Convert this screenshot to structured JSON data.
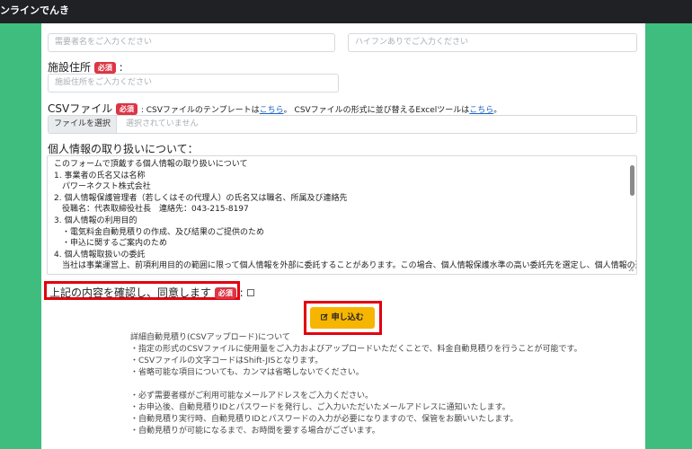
{
  "window": {
    "title": "ンラインでんき"
  },
  "form": {
    "top_row": {
      "left_placeholder": "需要者名をご入力ください",
      "right_placeholder": "ハイフンありでご入力ください"
    },
    "facility_address": {
      "label": "施設住所",
      "required_badge": "必須",
      "colon": ":",
      "placeholder": "施設住所をご入力ください"
    },
    "csv": {
      "label": "CSVファイル",
      "required_badge": "必須",
      "note_prefix": ": CSVファイルのテンプレートは",
      "template_link": "こちら",
      "note_middle": "。 CSVファイルの形式に並び替えるExcelツールは",
      "tool_link": "こちら",
      "note_suffix": "。",
      "file_button": "ファイルを選択",
      "file_status": "選択されていません"
    },
    "privacy": {
      "heading": "個人情報の取り扱いについて：",
      "lines": [
        "このフォームで頂戴する個人情報の取り扱いについて",
        "1. 事業者の氏名又は名称",
        "　パワーネクスト株式会社",
        "2. 個人情報保護管理者（若しくはその代理人）の氏名又は職名、所属及び連絡先",
        "　役職名：代表取締役社長　連絡先：043-215-8197",
        "3. 個人情報の利用目的",
        "　・電気料金自動見積りの作成、及び結果のご提供のため",
        "　・申込に関するご案内のため",
        "4. 個人情報取扱いの委託",
        "　当社は事業運営上、前項利用目的の範囲に限って個人情報を外部に委託することがあります。この場合、個人情報保護水準の高い委託先を選定し、個人情報の適正管理"
      ]
    },
    "consent": {
      "label": "上記の内容を確認し、同意します",
      "required_badge": "必須",
      "colon": ":"
    },
    "submit": {
      "icon": "edit-icon",
      "label": "申し込む"
    }
  },
  "notes": {
    "lines": [
      "詳細自動見積り(CSVアップロード)について",
      "・指定の形式のCSVファイルに使用量をご入力およびアップロードいただくことで、料金自動見積りを行うことが可能です。",
      "・CSVファイルの文字コードはShift-JISとなります。",
      "・省略可能な項目についても、カンマは省略しないでください。",
      "",
      "・必ず需要者様がご利用可能なメールアドレスをご入力ください。",
      "・お申込後、自動見積りIDとパスワードを発行し、ご入力いただいたメールアドレスに通知いたします。",
      "・自動見積り実行時、自動見積りIDとパスワードの入力が必要になりますので、保管をお願いいたします。",
      "・自動見積りが可能になるまで、お時間を要する場合がございます。"
    ]
  },
  "colors": {
    "accent_green": "#3ebd7e",
    "required_red": "#dc3545",
    "highlight_red": "#e3000f",
    "button_yellow": "#f6b500"
  }
}
